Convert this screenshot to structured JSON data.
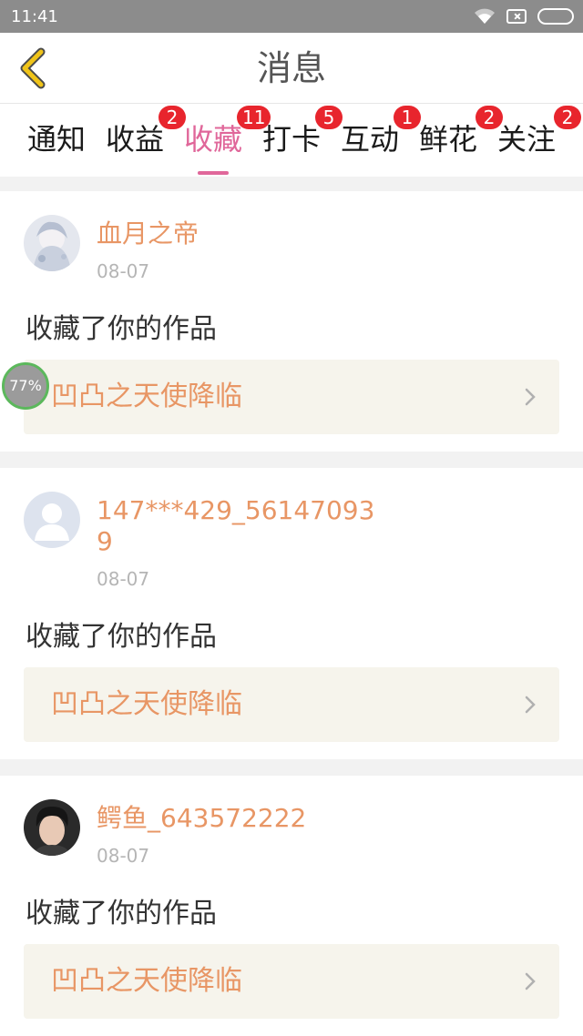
{
  "status_bar": {
    "time": "11:41"
  },
  "header": {
    "title": "消息"
  },
  "tabs": [
    {
      "label": "通知",
      "badge": null,
      "active": false
    },
    {
      "label": "收益",
      "badge": "2",
      "active": false
    },
    {
      "label": "收藏",
      "badge": "11",
      "active": true
    },
    {
      "label": "打卡",
      "badge": "5",
      "active": false
    },
    {
      "label": "互动",
      "badge": "1",
      "active": false
    },
    {
      "label": "鲜花",
      "badge": "2",
      "active": false
    },
    {
      "label": "关注",
      "badge": "2",
      "active": false
    }
  ],
  "messages": [
    {
      "username": "血月之帝",
      "date": "08-07",
      "action": "收藏了你的作品",
      "work_title": "凹凸之天使降临",
      "avatar": "anime-illustration-avatar"
    },
    {
      "username": "147***429_561470939",
      "date": "08-07",
      "action": "收藏了你的作品",
      "work_title": "凹凸之天使降临",
      "avatar": "default-user-avatar"
    },
    {
      "username": "鳄鱼_643572222",
      "date": "08-07",
      "action": "收藏了你的作品",
      "work_title": "凹凸之天使降临",
      "avatar": "photo-portrait-avatar"
    }
  ],
  "floating_progress": {
    "label": "77%"
  },
  "colors": {
    "accent": "#e0679a",
    "badge": "#e8252d",
    "username": "#e89665",
    "back_icon": "#f0c419"
  }
}
